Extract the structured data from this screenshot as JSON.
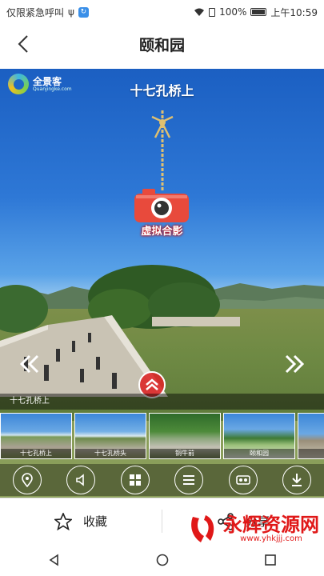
{
  "statusbar": {
    "left_text": "仅限紧急呼叫",
    "battery": "100%",
    "time": "上午10:59"
  },
  "nav": {
    "title": "颐和园"
  },
  "pano": {
    "logo_text": "全景客",
    "logo_sub": "Quanjingke.com",
    "scene_title": "十七孔桥上",
    "camera_label": "虚拟合影",
    "current_label": "十七孔桥上",
    "thumbs": [
      {
        "label": "十七孔桥上"
      },
      {
        "label": "十七孔桥头"
      },
      {
        "label": "铜牛前"
      },
      {
        "label": "颐和园"
      },
      {
        "label": ""
      }
    ]
  },
  "actions": {
    "favorite_label": "收藏",
    "share_label": "分享"
  },
  "watermark": {
    "text": "永辉资源网",
    "url": "www.yhkjjj.com"
  }
}
